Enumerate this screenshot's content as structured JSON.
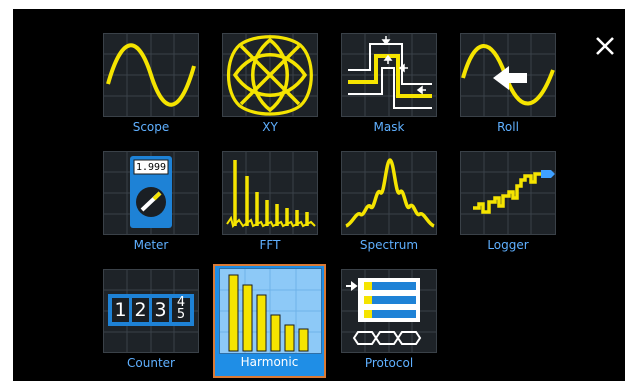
{
  "close_label": "close",
  "apps": [
    {
      "label": "Scope",
      "icon": "sine-wave-icon"
    },
    {
      "label": "XY",
      "icon": "lissajous-icon"
    },
    {
      "label": "Mask",
      "icon": "mask-icon"
    },
    {
      "label": "Roll",
      "icon": "roll-arrow-icon"
    },
    {
      "label": "Meter",
      "icon": "multimeter-icon",
      "reading": "1.999"
    },
    {
      "label": "FFT",
      "icon": "fft-spectrum-icon"
    },
    {
      "label": "Spectrum",
      "icon": "spectrum-icon"
    },
    {
      "label": "Logger",
      "icon": "logger-icon"
    },
    {
      "label": "Counter",
      "icon": "counter-icon",
      "digits": [
        "1",
        "2",
        "3",
        "4",
        "5"
      ]
    },
    {
      "label": "Harmonic",
      "icon": "harmonic-bars-icon",
      "selected": true
    },
    {
      "label": "Protocol",
      "icon": "protocol-icon"
    }
  ],
  "colors": {
    "accent": "#f5e400",
    "label": "#5fb0ff",
    "selected_bg": "#1f8ee6",
    "selected_border": "#d97a36"
  }
}
